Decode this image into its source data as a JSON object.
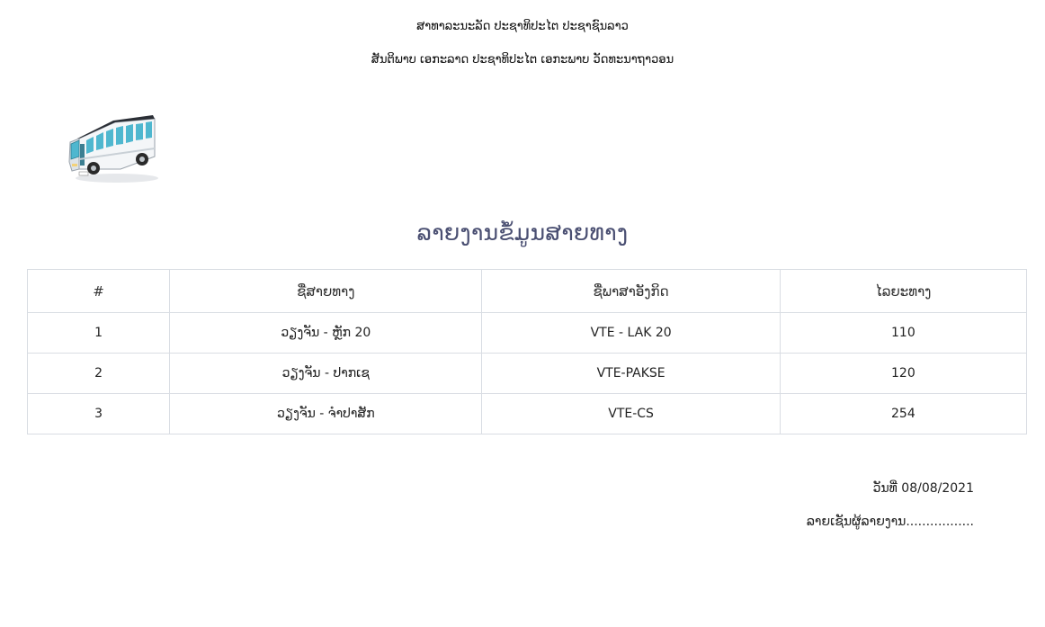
{
  "header": {
    "line1": "ສາທາລະນະລັດ ປະຊາທິປະໄຕ ປະຊາຊົນລາວ",
    "line2": "ສັນຕິພາບ ເອກະລາດ ປະຊາທິປະໄຕ ເອກະພາບ ວັດທະນາຖາວອນ"
  },
  "logo": {
    "icon": "bus-icon",
    "colors": {
      "body": "#f4f6f8",
      "windows": "#4fb7cf",
      "roof": "#2b2f36",
      "wheels": "#2a2a2a"
    }
  },
  "report": {
    "title": "ລາຍງານຂໍ້ມູນສາຍທາງ"
  },
  "table": {
    "headers": [
      "#",
      "ຊື່ສາຍທາງ",
      "ຊື່ພາສາອັງກິດ",
      "ໄລຍະທາງ"
    ],
    "rows": [
      [
        "1",
        "ວຽງຈັນ - ຫຼັກ 20",
        "VTE - LAK 20",
        "110"
      ],
      [
        "2",
        "ວຽງຈັນ - ປາກເຊ",
        "VTE-PAKSE",
        "120"
      ],
      [
        "3",
        "ວຽງຈັນ - ຈຳປາສັກ",
        "VTE-CS",
        "254"
      ]
    ]
  },
  "footer": {
    "date": "ວັນທີ່ 08/08/2021",
    "signature": "ລາຍເຊັນຜູ້ລາຍງານ................."
  }
}
